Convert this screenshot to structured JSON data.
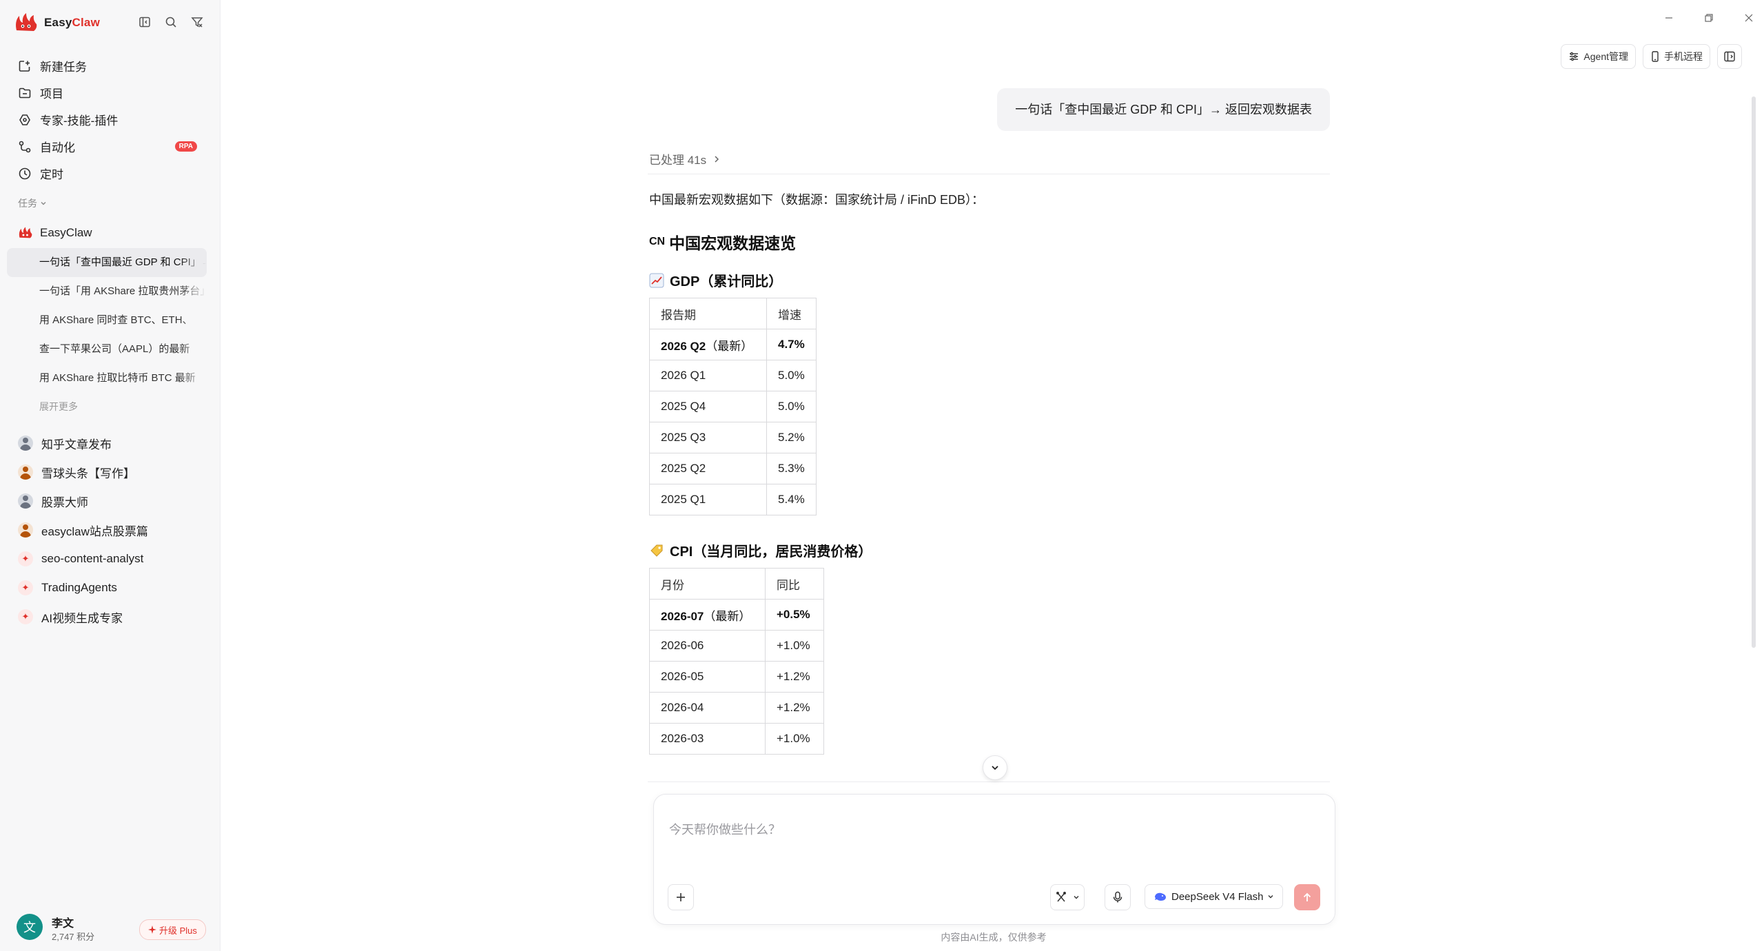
{
  "brand": {
    "name_a": "Easy",
    "name_b": "Claw"
  },
  "nav": [
    {
      "label": "新建任务",
      "icon": "new-task-icon"
    },
    {
      "label": "项目",
      "icon": "folder-icon"
    },
    {
      "label": "专家-技能-插件",
      "icon": "plugin-icon"
    },
    {
      "label": "自动化",
      "icon": "automation-icon",
      "badge": "RPA"
    },
    {
      "label": "定时",
      "icon": "clock-icon"
    }
  ],
  "tasks_section": {
    "label": "任务"
  },
  "task_group": {
    "title": "EasyClaw",
    "items": [
      "一句话「查中国最近 GDP 和 CPI」→ 返回宏观数据表",
      "一句话「用 AKShare 拉取贵州茅台」",
      "用 AKShare 同时查 BTC、ETH、",
      "查一下苹果公司（AAPL）的最新",
      "用 AKShare 拉取比特币 BTC 最新"
    ],
    "expand_more": "展开更多"
  },
  "agents": [
    {
      "label": "知乎文章发布",
      "avatar": "person"
    },
    {
      "label": "雪球头条【写作】",
      "avatar": "warm"
    },
    {
      "label": "股票大师",
      "avatar": "person"
    },
    {
      "label": "easyclaw站点股票篇",
      "avatar": "warm"
    },
    {
      "label": "seo-content-analyst",
      "avatar": "claw"
    },
    {
      "label": "TradingAgents",
      "avatar": "claw"
    },
    {
      "label": "AI视频生成专家",
      "avatar": "claw"
    }
  ],
  "user": {
    "initial": "文",
    "name": "李文",
    "points": "2,747 积分",
    "upgrade": "升级 Plus"
  },
  "topbar": {
    "agent_mgmt": "Agent管理",
    "phone_remote": "手机远程"
  },
  "conversation": {
    "user_message": "一句话「查中国最近 GDP 和 CPI」→ 返回宏观数据表",
    "processed": "已处理 41s",
    "intro": "中国最新宏观数据如下（数据源：国家统计局 / iFinD EDB）：",
    "flag_text": "CN",
    "heading": "中国宏观数据速览",
    "gdp_title": "GDP（累计同比）",
    "gdp_table": {
      "headers": [
        "报告期",
        "增速"
      ],
      "rows": [
        {
          "period": "2026 Q2",
          "note": "（最新）",
          "value": "4.7%"
        },
        {
          "period": "2026 Q1",
          "value": "5.0%"
        },
        {
          "period": "2025 Q4",
          "value": "5.0%"
        },
        {
          "period": "2025 Q3",
          "value": "5.2%"
        },
        {
          "period": "2025 Q2",
          "value": "5.3%"
        },
        {
          "period": "2025 Q1",
          "value": "5.4%"
        }
      ]
    },
    "cpi_title": "CPI（当月同比，居民消费价格）",
    "cpi_table": {
      "headers": [
        "月份",
        "同比"
      ],
      "rows": [
        {
          "period": "2026-07",
          "note": "（最新）",
          "value": "+0.5%"
        },
        {
          "period": "2026-06",
          "value": "+1.0%"
        },
        {
          "period": "2026-05",
          "value": "+1.2%"
        },
        {
          "period": "2026-04",
          "value": "+1.2%"
        },
        {
          "period": "2026-03",
          "value": "+1.0%"
        }
      ]
    }
  },
  "composer": {
    "placeholder": "今天帮你做些什么？",
    "model": "DeepSeek V4 Flash"
  },
  "disclaimer": "内容由AI生成，仅供参考",
  "colors": {
    "accent": "#e0312b",
    "send_disabled": "#f4a09d",
    "sidebar_bg": "#f7f7f8",
    "avatar": "#139189"
  }
}
